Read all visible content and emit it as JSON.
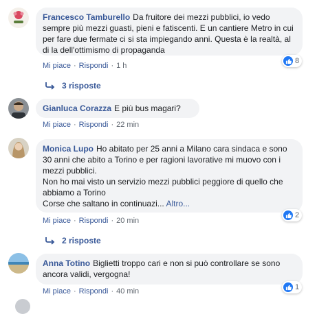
{
  "comments": [
    {
      "author": "Francesco Tamburello",
      "text": "Da fruitore dei mezzi pubblici, io vedo sempre più mezzi guasti, pieni e fatiscenti. E un cantiere Metro in cui per fare due fermate ci si sta impiegando anni. Questa è la realtà, al di la dell'ottimismo di propaganda",
      "like_label": "Mi piace",
      "reply_label": "Rispondi",
      "time": "1 h",
      "reaction_count": "8",
      "replies_label": "3 risposte"
    },
    {
      "author": "Gianluca Corazza",
      "text": "E più bus magari?",
      "like_label": "Mi piace",
      "reply_label": "Rispondi",
      "time": "22 min"
    },
    {
      "author": "Monica Lupo",
      "text_lines": [
        "Ho abitato per 25 anni a Milano cara sindaca e sono 30 anni che abito a Torino e per ragioni lavorative mi muovo con i mezzi pubblici.",
        "Non ho mai visto un servizio mezzi pubblici peggiore di quello che abbiamo a Torino",
        "Corse che saltano in continuazi..."
      ],
      "more_label": "Altro...",
      "like_label": "Mi piace",
      "reply_label": "Rispondi",
      "time": "20 min",
      "reaction_count": "2",
      "replies_label": "2 risposte"
    },
    {
      "author": "Anna Totino",
      "text": "Biglietti troppo cari e non si può controllare se sono ancora validi, vergogna!",
      "like_label": "Mi piace",
      "reply_label": "Rispondi",
      "time": "40 min",
      "reaction_count": "1"
    }
  ],
  "colors": {
    "link": "#385898",
    "bubble": "#f2f3f5",
    "meta": "#606770",
    "like_blue": "#2078f4"
  }
}
